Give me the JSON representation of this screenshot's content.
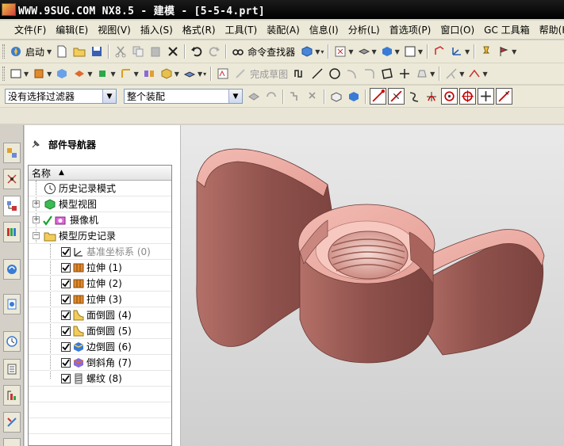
{
  "window": {
    "title": "WWW.9SUG.COM NX8.5 - 建模 - [5-5-4.prt]"
  },
  "menu": {
    "items": [
      "文件(F)",
      "编辑(E)",
      "视图(V)",
      "插入(S)",
      "格式(R)",
      "工具(T)",
      "装配(A)",
      "信息(I)",
      "分析(L)",
      "首选项(P)",
      "窗口(O)",
      "GC 工具箱",
      "帮助(H)"
    ]
  },
  "toolbar": {
    "start_label": "启动",
    "command_finder_label": "命令查找器",
    "finish_sketch_label": "完成草图"
  },
  "selection": {
    "filter_value": "没有选择过滤器",
    "scope_value": "整个装配"
  },
  "navigator": {
    "title": "部件导航器",
    "column_name": "名称",
    "top_items": [
      {
        "label": "历史记录模式",
        "icon": "clock-icon"
      },
      {
        "label": "模型视图",
        "icon": "model-views-icon"
      },
      {
        "label": "摄像机",
        "icon": "camera-icon"
      },
      {
        "label": "模型历史记录",
        "icon": "folder-icon"
      }
    ],
    "features": [
      {
        "label": "基准坐标系 (0)",
        "icon": "datum-csys-icon",
        "checked": true,
        "greyed": true
      },
      {
        "label": "拉伸 (1)",
        "icon": "extrude-icon",
        "checked": true
      },
      {
        "label": "拉伸 (2)",
        "icon": "extrude-icon",
        "checked": true
      },
      {
        "label": "拉伸 (3)",
        "icon": "extrude-icon",
        "checked": true
      },
      {
        "label": "面倒圆 (4)",
        "icon": "face-blend-icon",
        "checked": true
      },
      {
        "label": "面倒圆 (5)",
        "icon": "face-blend-icon",
        "checked": true
      },
      {
        "label": "边倒圆 (6)",
        "icon": "edge-blend-icon",
        "checked": true
      },
      {
        "label": "倒斜角 (7)",
        "icon": "chamfer-icon",
        "checked": true
      },
      {
        "label": "螺纹 (8)",
        "icon": "thread-icon",
        "checked": true
      }
    ]
  },
  "colors": {
    "model_face": "#e8a9a0",
    "model_side": "#9b5c57",
    "viewport_bg": "#dcdcdc"
  }
}
